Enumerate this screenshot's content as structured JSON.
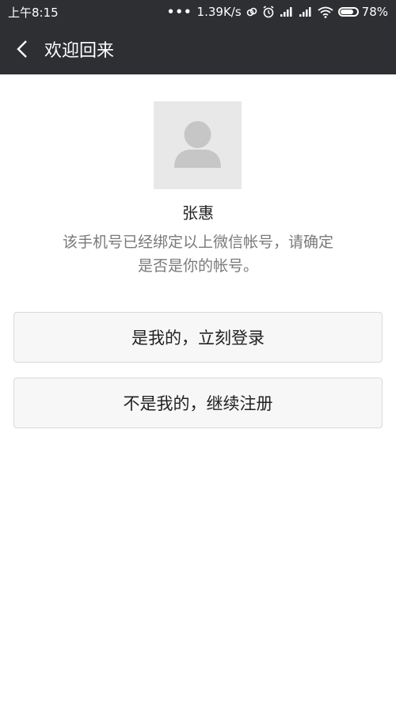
{
  "status_bar": {
    "time": "上午8:15",
    "network_speed": "1.39K/s",
    "battery_percent": "78%",
    "battery_level": 0.78,
    "icons": [
      "more-dots-icon",
      "link-icon",
      "alarm-icon",
      "signal-icon",
      "signal-icon",
      "wifi-icon",
      "battery-icon"
    ]
  },
  "header": {
    "title": "欢迎回来"
  },
  "profile": {
    "name": "张惠",
    "message_line1": "该手机号已经绑定以上微信帐号，请确定",
    "message_line2": "是否是你的帐号。"
  },
  "actions": {
    "login_label": "是我的，立刻登录",
    "register_label": "不是我的，继续注册"
  },
  "colors": {
    "bar_background": "#2e2f33",
    "avatar_background": "#e8e8e8",
    "button_background": "#f7f7f7"
  }
}
